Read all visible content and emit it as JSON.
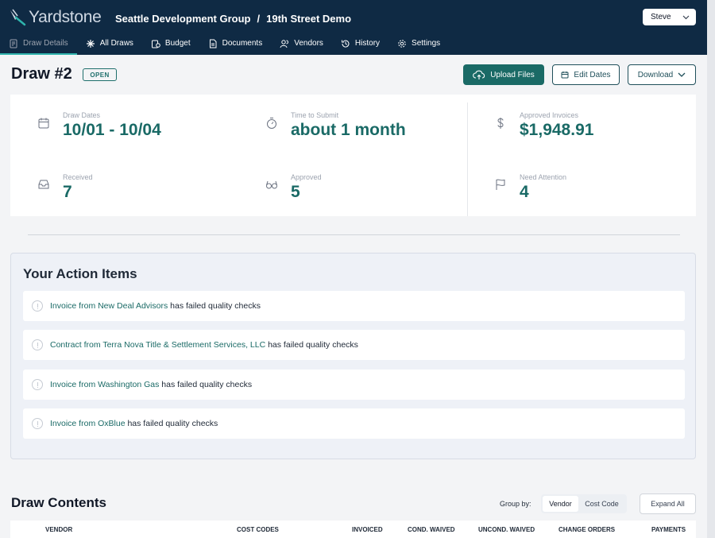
{
  "app": {
    "logo_text": "Yardstone"
  },
  "breadcrumb": {
    "org": "Seattle Development Group",
    "separator": "/",
    "project": "19th Street Demo"
  },
  "user_menu": {
    "label": "Steve"
  },
  "nav": {
    "items": [
      {
        "label": "Draw Details",
        "icon": "draw-details-icon",
        "active": true
      },
      {
        "label": "All Draws",
        "icon": "asterisk-icon"
      },
      {
        "label": "Budget",
        "icon": "budget-icon"
      },
      {
        "label": "Documents",
        "icon": "document-icon"
      },
      {
        "label": "Vendors",
        "icon": "users-icon"
      },
      {
        "label": "History",
        "icon": "history-icon"
      },
      {
        "label": "Settings",
        "icon": "gear-icon"
      }
    ]
  },
  "draw": {
    "title": "Draw #2",
    "status": "OPEN",
    "buttons": {
      "upload": "Upload Files",
      "edit_dates": "Edit Dates",
      "download": "Download"
    }
  },
  "stats": {
    "draw_dates": {
      "label": "Draw Dates",
      "value": "10/01 - 10/04",
      "icon": "calendar-icon"
    },
    "time_to_submit": {
      "label": "Time to Submit",
      "value": "about 1 month",
      "icon": "stopwatch-icon"
    },
    "approved_invoices": {
      "label": "Approved Invoices",
      "value": "$1,948.91",
      "icon": "dollar-icon"
    },
    "received": {
      "label": "Received",
      "value": "7",
      "icon": "inbox-icon"
    },
    "approved": {
      "label": "Approved",
      "value": "5",
      "icon": "glasses-icon"
    },
    "need_attention": {
      "label": "Need Attention",
      "value": "4",
      "icon": "flag-icon"
    }
  },
  "action_items": {
    "title": "Your Action Items",
    "items": [
      {
        "link": "Invoice from New Deal Advisors",
        "text": " has failed quality checks"
      },
      {
        "link": "Contract from Terra Nova Title & Settlement Services, LLC",
        "text": " has failed quality checks"
      },
      {
        "link": "Invoice from Washington Gas",
        "text": " has failed quality checks"
      },
      {
        "link": "Invoice from OxBlue",
        "text": " has failed quality checks"
      }
    ]
  },
  "draw_contents": {
    "title": "Draw Contents",
    "group_by_label": "Group by:",
    "group_options": {
      "selected": "Vendor",
      "other": "Cost Code"
    },
    "expand_all": "Expand All",
    "columns": [
      "VENDOR",
      "COST CODES",
      "INVOICED",
      "COND. WAIVED",
      "UNCOND. WAIVED",
      "CHANGE ORDERS",
      "PAYMENTS"
    ]
  },
  "colors": {
    "header_bg": "#0f2a44",
    "accent": "#1a6a66",
    "nav_active_underline": "#2fb4ad"
  }
}
